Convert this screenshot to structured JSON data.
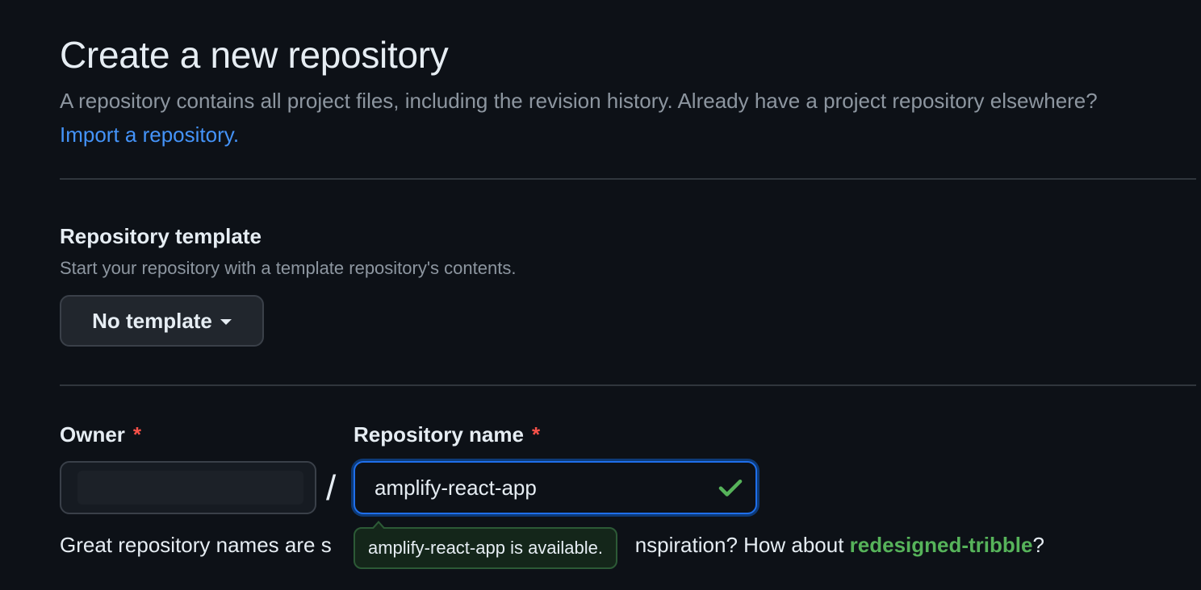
{
  "header": {
    "title": "Create a new repository",
    "subtitle": "A repository contains all project files, including the revision history. Already have a project repository elsewhere?",
    "import_link": "Import a repository."
  },
  "template_section": {
    "title": "Repository template",
    "description": "Start your repository with a template repository's contents.",
    "button_label": "No template"
  },
  "owner": {
    "label": "Owner",
    "required_marker": "*"
  },
  "separator": "/",
  "repository_name": {
    "label": "Repository name",
    "required_marker": "*",
    "value": "amplify-react-app"
  },
  "hint": {
    "prefix": "Great repository names are s",
    "middle": "nspiration? How about ",
    "suggestion": "redesigned-tribble",
    "suffix": "?"
  },
  "tooltip": {
    "text": "amplify-react-app is available."
  },
  "icons": {
    "valid": "check-icon",
    "dropdown": "caret-down-icon"
  },
  "colors": {
    "background": "#0d1117",
    "link": "#4493f8",
    "focus": "#1f6feb",
    "success": "#56b35a",
    "danger": "#f85149"
  }
}
